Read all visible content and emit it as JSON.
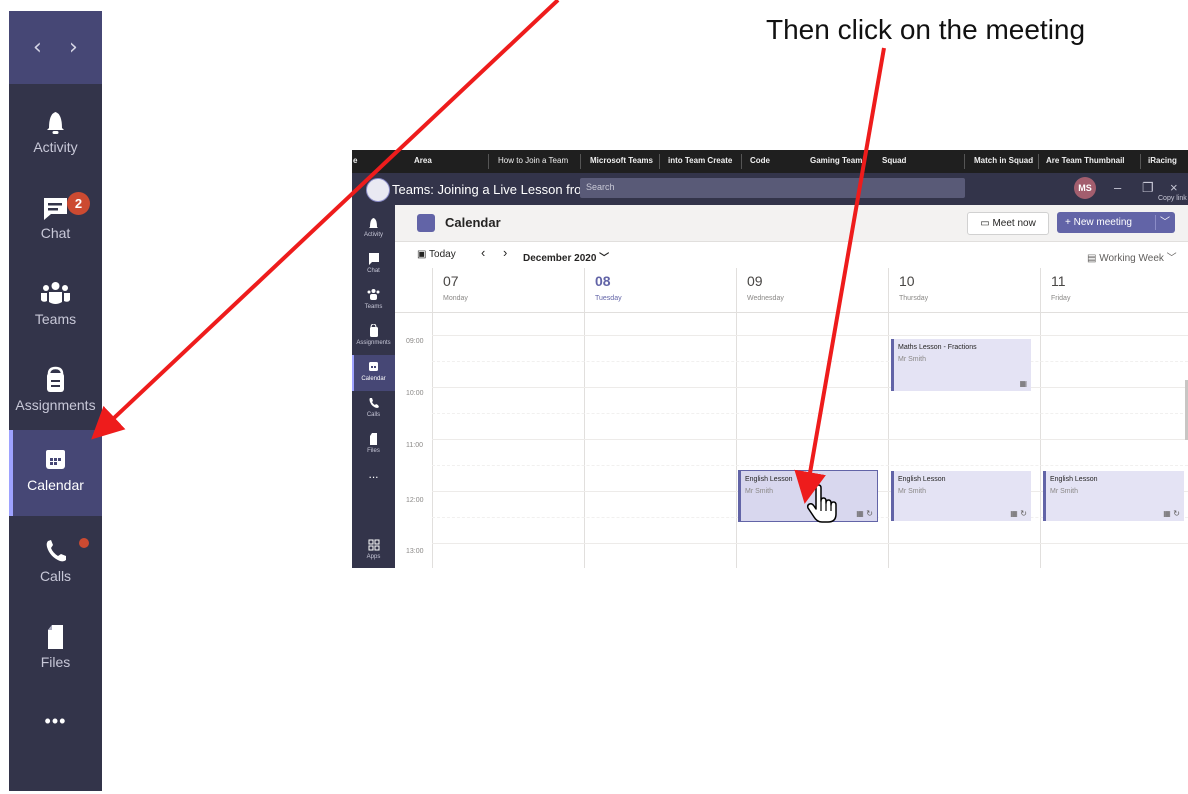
{
  "caption": "Then click on the meeting",
  "big_rail": {
    "nav_back": "‹",
    "nav_forward": "›",
    "items": [
      {
        "label": "Activity",
        "icon": "bell-icon"
      },
      {
        "label": "Chat",
        "icon": "chat-icon",
        "badge": "2"
      },
      {
        "label": "Teams",
        "icon": "teams-icon"
      },
      {
        "label": "Assignments",
        "icon": "assignments-icon"
      },
      {
        "label": "Calendar",
        "icon": "calendar-icon",
        "active": true
      },
      {
        "label": "Calls",
        "icon": "phone-icon",
        "dot": true
      },
      {
        "label": "Files",
        "icon": "file-icon"
      },
      {
        "label": "•••",
        "icon": "more-icon"
      }
    ]
  },
  "inset": {
    "bookmarks": [
      "e",
      "Area",
      "How to Join a Team",
      "Microsoft Teams",
      "into Team Create",
      "Code",
      "Gaming Team",
      "Squad",
      "Match in Squad",
      "Are Team Thumbnail",
      "iRacing"
    ],
    "window_title": "Teams: Joining a Live Lesson from a Computer",
    "search_placeholder": "Search",
    "avatar_initials": "MS",
    "copy_link": "Copy link",
    "mini_rail": [
      {
        "label": "Activity"
      },
      {
        "label": "Chat"
      },
      {
        "label": "Teams"
      },
      {
        "label": "Assignments"
      },
      {
        "label": "Calendar",
        "active": true
      },
      {
        "label": "Calls"
      },
      {
        "label": "Files"
      },
      {
        "label": "..."
      },
      {
        "label": "Apps"
      }
    ],
    "calendar": {
      "title": "Calendar",
      "meet_now": "Meet now",
      "new_meeting": "+  New meeting",
      "today": "Today",
      "month": "December 2020",
      "view": "Working Week",
      "days": [
        {
          "num": "07",
          "name": "Monday"
        },
        {
          "num": "08",
          "name": "Tuesday",
          "today": true
        },
        {
          "num": "09",
          "name": "Wednesday"
        },
        {
          "num": "10",
          "name": "Thursday"
        },
        {
          "num": "11",
          "name": "Friday"
        }
      ],
      "times": [
        "09:00",
        "10:00",
        "11:00",
        "12:00",
        "13:00"
      ],
      "events": [
        {
          "title": "Maths Lesson - Fractions",
          "organizer": "Mr Smith"
        },
        {
          "title": "English Lesson",
          "organizer": "Mr Smith"
        },
        {
          "title": "English Lesson",
          "organizer": "Mr Smith"
        },
        {
          "title": "English Lesson",
          "organizer": "Mr Smith"
        }
      ]
    }
  }
}
